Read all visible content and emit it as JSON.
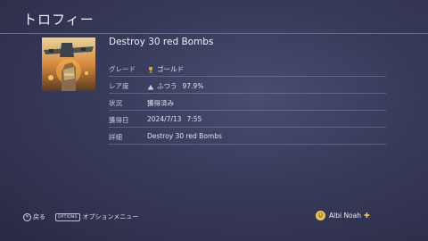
{
  "header": {
    "title": "トロフィー"
  },
  "trophy": {
    "name": "Destroy 30 red Bombs",
    "rows": [
      {
        "key": "グレード",
        "value": "ゴールド",
        "icon": "gold-trophy-icon"
      },
      {
        "key": "レア度",
        "value": "ふつう",
        "value2": "97.9%",
        "icon": "rarity-icon"
      },
      {
        "key": "状況",
        "value": "獲得済み"
      },
      {
        "key": "獲得日",
        "value": "2024/7/13",
        "value2": "7:55"
      },
      {
        "key": "詳細",
        "value": "Destroy 30 red Bombs"
      }
    ]
  },
  "footer": {
    "back_label": "戻る",
    "options_tag": "OPTIONS",
    "options_label": "オプションメニュー",
    "user_name": "Albi Noah"
  },
  "colors": {
    "gold": "#d8a43a",
    "plus": "#f3c83c"
  }
}
